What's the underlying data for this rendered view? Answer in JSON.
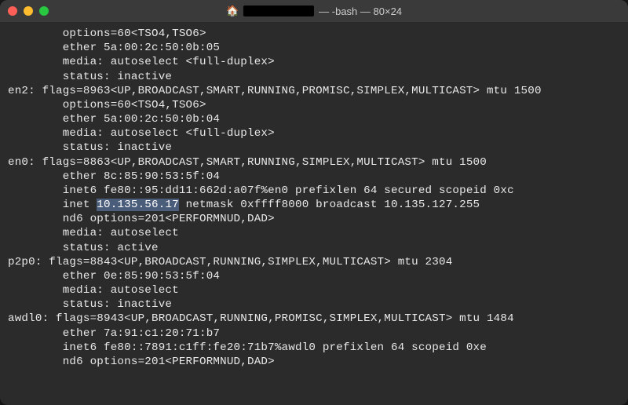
{
  "titlebar": {
    "house_icon": "🏠",
    "title_suffix": " — -bash — 80×24"
  },
  "lines": [
    "        options=60<TSO4,TSO6>",
    "        ether 5a:00:2c:50:0b:05",
    "        media: autoselect <full-duplex>",
    "        status: inactive",
    "en2: flags=8963<UP,BROADCAST,SMART,RUNNING,PROMISC,SIMPLEX,MULTICAST> mtu 1500",
    "        options=60<TSO4,TSO6>",
    "        ether 5a:00:2c:50:0b:04",
    "        media: autoselect <full-duplex>",
    "        status: inactive",
    "en0: flags=8863<UP,BROADCAST,SMART,RUNNING,SIMPLEX,MULTICAST> mtu 1500",
    "        ether 8c:85:90:53:5f:04",
    "        inet6 fe80::95:dd11:662d:a07f%en0 prefixlen 64 secured scopeid 0xc",
    {
      "pre": "        inet ",
      "hl": "10.135.56.17",
      "post": " netmask 0xffff8000 broadcast 10.135.127.255"
    },
    "        nd6 options=201<PERFORMNUD,DAD>",
    "        media: autoselect",
    "        status: active",
    "p2p0: flags=8843<UP,BROADCAST,RUNNING,SIMPLEX,MULTICAST> mtu 2304",
    "        ether 0e:85:90:53:5f:04",
    "        media: autoselect",
    "        status: inactive",
    "awdl0: flags=8943<UP,BROADCAST,RUNNING,PROMISC,SIMPLEX,MULTICAST> mtu 1484",
    "        ether 7a:91:c1:20:71:b7",
    "        inet6 fe80::7891:c1ff:fe20:71b7%awdl0 prefixlen 64 scopeid 0xe",
    "        nd6 options=201<PERFORMNUD,DAD>"
  ]
}
